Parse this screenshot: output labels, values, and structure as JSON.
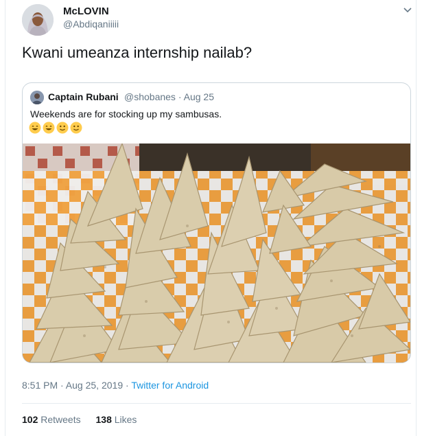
{
  "tweet": {
    "author_name": "McLOVIN",
    "author_handle": "@Abdiqaniiiii",
    "text": "Kwani umeanza internship nailab?",
    "timestamp": "8:51 PM · Aug 25, 2019",
    "separator": " · ",
    "source": "Twitter for Android",
    "avatar_icon": "avatar-woman-hijab-icon",
    "menu_icon": "chevron-down-icon"
  },
  "quoted": {
    "author_name": "Captain Rubani",
    "author_handle": "@shobanes",
    "date": "Aug 25",
    "dot": " · ",
    "text": "Weekends are for stocking up my sambusas.",
    "emojis": [
      "grinning-face",
      "grinning-face",
      "slightly-smiling-face",
      "slightly-smiling-face"
    ],
    "image": "photo-of-sambusas-on-tray"
  },
  "stats": {
    "retweets_count": "102",
    "retweets_label": "Retweets",
    "likes_count": "138",
    "likes_label": "Likes"
  },
  "colors": {
    "link_blue": "#1b95e0",
    "secondary_text": "#657786",
    "primary_text": "#14171a",
    "border": "#ccd6dd"
  }
}
